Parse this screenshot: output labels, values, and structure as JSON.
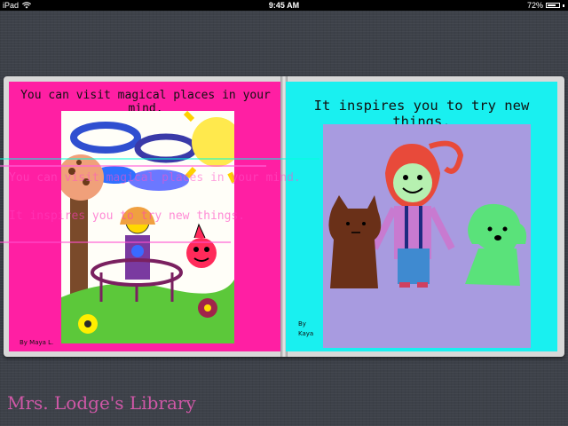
{
  "status_bar": {
    "device": "iPad",
    "time": "9:45 AM",
    "battery": "72%",
    "battery_level": 0.72
  },
  "book": {
    "left_page": {
      "text": "You can visit magical places in your mind.",
      "byline": "By Maya L."
    },
    "right_page": {
      "text": "It inspires you to try new things.",
      "byline_line1": "By",
      "byline_line2": "Kaya"
    }
  },
  "ghost_text": {
    "line1": "You can visit magical places in your mind.",
    "line2": "It inspires you to try new things."
  },
  "footer": {
    "label": "Mrs. Lodge's Library"
  },
  "colors": {
    "left_page": "#ff1fa3",
    "right_page": "#19f0f0",
    "background": "#3d4149"
  }
}
